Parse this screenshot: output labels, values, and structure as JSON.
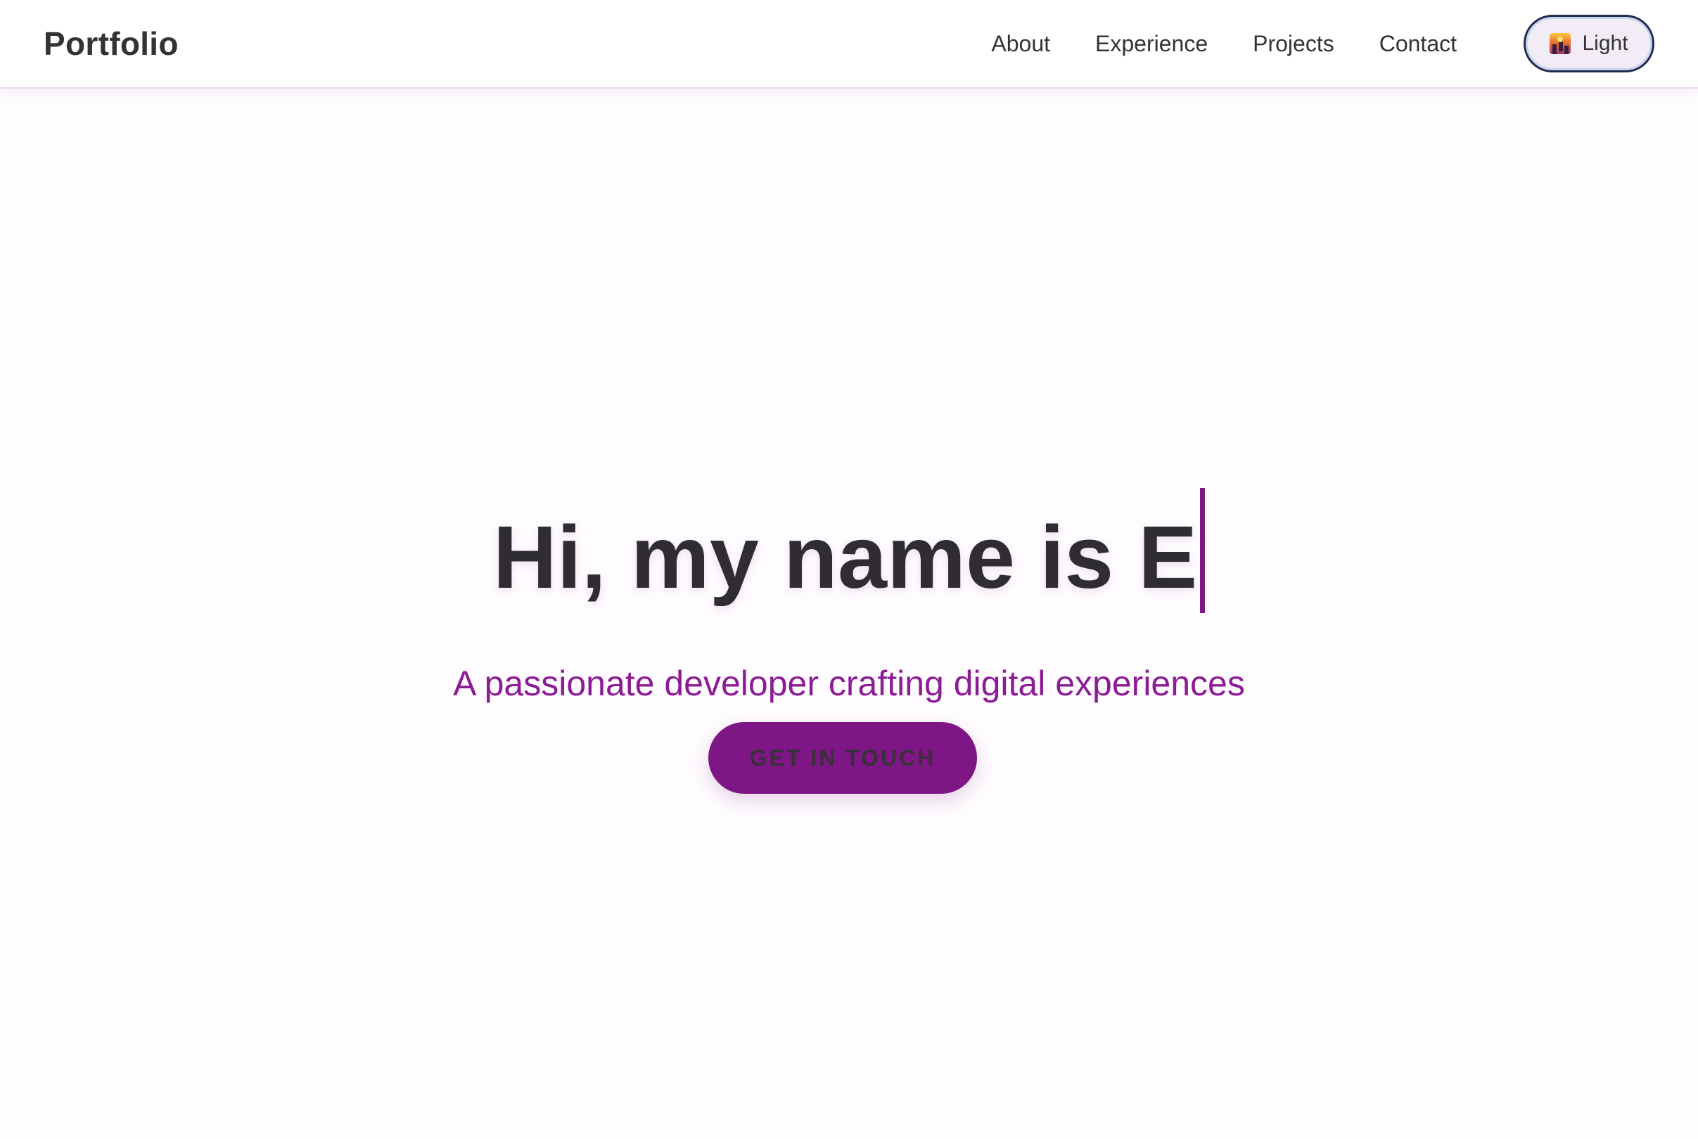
{
  "navbar": {
    "brand": "Portfolio",
    "links": [
      {
        "label": "About"
      },
      {
        "label": "Experience"
      },
      {
        "label": "Projects"
      },
      {
        "label": "Contact"
      }
    ],
    "theme_toggle": {
      "icon": "sunset-icon",
      "label": "Light"
    }
  },
  "hero": {
    "heading": "Hi, my name is E",
    "subtitle": "A passionate developer crafting digital experiences",
    "cta_label": "GET IN TOUCH"
  },
  "colors": {
    "accent": "#7e1785",
    "subtitle": "#8c1c95",
    "text": "#333333",
    "background": "#fefcfe"
  }
}
